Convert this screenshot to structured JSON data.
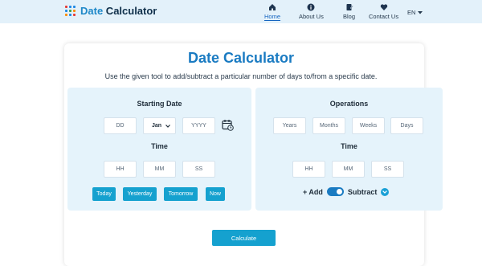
{
  "brand": {
    "name_prefix": "Date",
    "name_suffix": " Calculator",
    "icon": "calendar-dots-icon"
  },
  "nav": [
    {
      "label": "Home",
      "icon": "home-icon",
      "active": true
    },
    {
      "label": "About Us",
      "icon": "info-icon",
      "active": false
    },
    {
      "label": "Blog",
      "icon": "blog-icon",
      "active": false
    },
    {
      "label": "Contact Us",
      "icon": "heart-icon",
      "active": false
    }
  ],
  "language": {
    "value": "EN",
    "icon": "caret-down-icon"
  },
  "main": {
    "title": "Date Calculator",
    "subtitle": "Use the given tool to add/subtract a particular number of days to/from a specific date."
  },
  "starting": {
    "title": "Starting Date",
    "day_placeholder": "DD",
    "month_value": "Jan",
    "year_placeholder": "YYYY",
    "time_title": "Time",
    "hour_placeholder": "HH",
    "minute_placeholder": "MM",
    "second_placeholder": "SS",
    "quick_buttons": [
      "Today",
      "Yesterday",
      "Tomorrow",
      "Now"
    ]
  },
  "operations": {
    "title": "Operations",
    "years_placeholder": "Years",
    "months_placeholder": "Months",
    "weeks_placeholder": "Weeks",
    "days_placeholder": "Days",
    "time_title": "Time",
    "hour_placeholder": "HH",
    "minute_placeholder": "MM",
    "second_placeholder": "SS",
    "add_label": "+ Add",
    "subtract_label": "Subtract",
    "toggle_on": true
  },
  "calculate_label": "Calculate",
  "colors": {
    "accent": "#15a1cf",
    "title": "#1a7bc2",
    "panel": "#e5f3fb",
    "topbar": "#e3f1fa"
  }
}
